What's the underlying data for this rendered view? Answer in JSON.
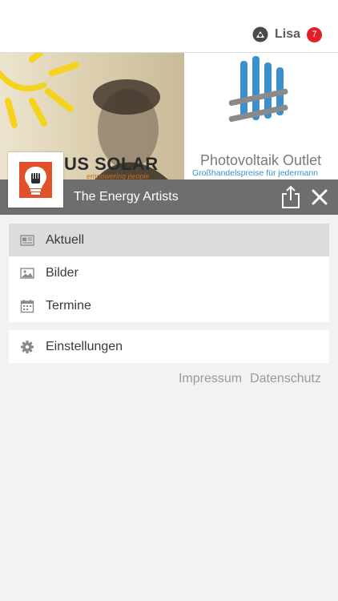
{
  "topbar": {
    "user_name": "Lisa",
    "notification_count": "7"
  },
  "banner": {
    "brand_name": "US SOLAR",
    "brand_tagline": "empowering people",
    "outlet_name": "Photovoltaik Outlet",
    "outlet_tagline": "Großhandelspreise für jedermann"
  },
  "header": {
    "title": "The Energy Artists"
  },
  "menu": {
    "items": [
      {
        "label": "Aktuell",
        "icon": "newspaper-icon",
        "active": true
      },
      {
        "label": "Bilder",
        "icon": "image-icon",
        "active": false
      },
      {
        "label": "Termine",
        "icon": "calendar-icon",
        "active": false
      }
    ],
    "settings": {
      "label": "Einstellungen",
      "icon": "gear-icon"
    }
  },
  "footer": {
    "impressum": "Impressum",
    "datenschutz": "Datenschutz"
  },
  "colors": {
    "header_bar": "#6e6e6e",
    "badge": "#e41e26",
    "active_item": "#dcdcdc",
    "background": "#f2f2f2"
  }
}
